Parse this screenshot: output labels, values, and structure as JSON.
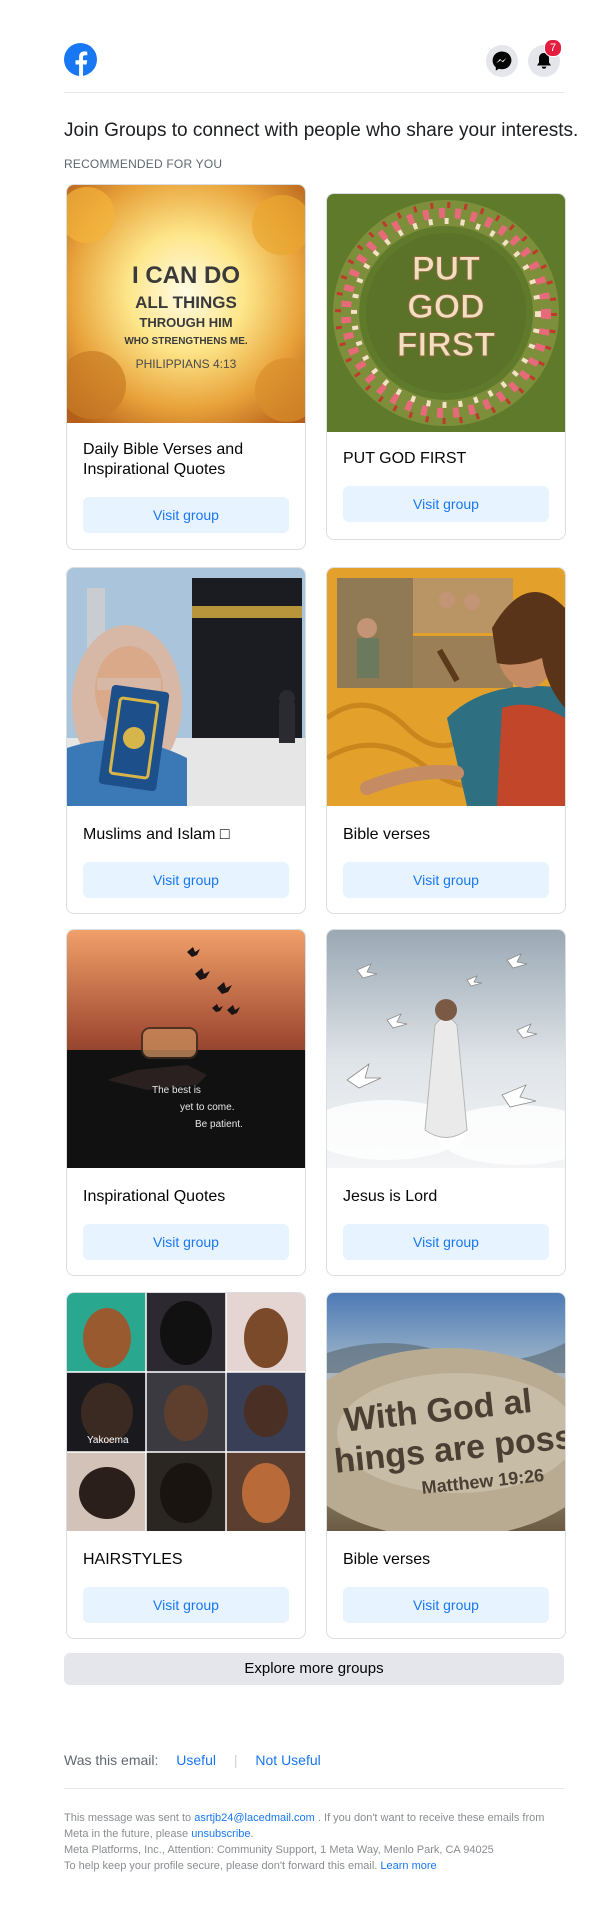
{
  "header": {
    "notification_count": "7"
  },
  "intro": "Join Groups to connect with people who share your interests.",
  "section_label": "RECOMMENDED FOR YOU",
  "groups": [
    {
      "name": "Daily Bible Verses and Inspirational Quotes",
      "button": "Visit group"
    },
    {
      "name": "PUT GOD FIRST",
      "button": "Visit group"
    },
    {
      "name": "Muslims and Islam □",
      "button": "Visit group"
    },
    {
      "name": "Bible verses",
      "button": "Visit group"
    },
    {
      "name": "Inspirational Quotes",
      "button": "Visit group"
    },
    {
      "name": "Jesus is Lord",
      "button": "Visit group"
    },
    {
      "name": "HAIRSTYLES",
      "button": "Visit group"
    },
    {
      "name": "Bible verses",
      "button": "Visit group"
    }
  ],
  "images": {
    "verse1": [
      "I CAN DO",
      "ALL THINGS",
      "THROUGH HIM",
      "WHO STRENGTHENS ME.",
      "PHILIPPIANS 4:13"
    ],
    "putgod": [
      "PUT",
      "GOD",
      "FIRST"
    ],
    "patient": [
      "The best is",
      "yet to come.",
      "Be patient."
    ],
    "hair_watermark": "Yakoema",
    "withgod": [
      "With God al",
      "hings are poss",
      "Matthew 19:26"
    ]
  },
  "explore": "Explore more groups",
  "feedback": {
    "question": "Was this email:",
    "useful": "Useful",
    "not_useful": "Not Useful"
  },
  "footer": {
    "line1_a": "This message was sent to",
    "email": "asrtjb24@lacedmail.com",
    "line1_b": ". If you don't want to receive these emails from Meta in the future, please",
    "unsubscribe": "unsubscribe",
    "line1_c": ".",
    "line2": "Meta Platforms, Inc., Attention: Community Support, 1 Meta Way, Menlo Park, CA 94025",
    "line3": "To help keep your profile secure, please don't forward this email.",
    "learn_more": "Learn more"
  },
  "colors": {
    "brand": "#1877f2",
    "badge": "#e41e3f",
    "button_bg": "#e7f3ff"
  }
}
